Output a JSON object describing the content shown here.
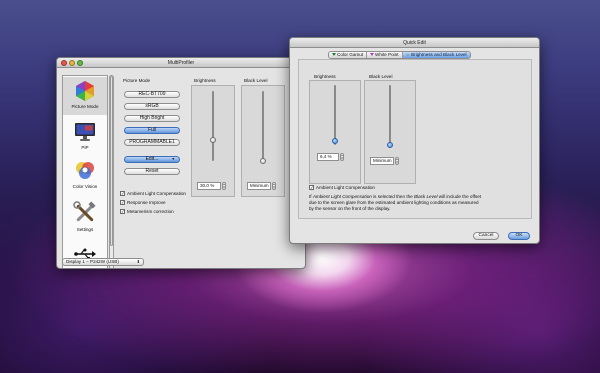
{
  "multiprofiler": {
    "title": "MultiProfiler",
    "sidebar": [
      {
        "label": "Picture Mode",
        "icon": "color-hexagon-icon",
        "selected": true
      },
      {
        "label": "PiP",
        "icon": "monitor-icon"
      },
      {
        "label": "Color Vision",
        "icon": "color-vision-icon"
      },
      {
        "label": "Settings",
        "icon": "tools-icon"
      },
      {
        "label": "",
        "icon": "usb-icon"
      }
    ],
    "picture_mode": {
      "heading": "Picture Mode",
      "buttons": [
        {
          "label": "REC-BT709",
          "active": false
        },
        {
          "label": "sRGB",
          "active": false
        },
        {
          "label": "High Bright",
          "active": false
        },
        {
          "label": "Full",
          "active": true
        },
        {
          "label": "PROGRAMMABLE1",
          "active": false
        }
      ],
      "edit_label": "Edit...",
      "reset_label": "Reset"
    },
    "brightness": {
      "heading": "Brightness",
      "value": "30,0 %",
      "level": 0.3
    },
    "black_level": {
      "heading": "Black Level",
      "value": "Minimum",
      "level": 0.0
    },
    "checkboxes": [
      {
        "label": "Ambient Light Compensation",
        "checked": true
      },
      {
        "label": "Response Improve",
        "checked": true
      },
      {
        "label": "Metamerism correction",
        "checked": true
      }
    ],
    "display_select": "Display 1 – P242W (USB)"
  },
  "quickedit": {
    "title": "Quick Edit",
    "tabs": [
      {
        "label": "Color Gamut",
        "selected": false
      },
      {
        "label": "White Point",
        "selected": false
      },
      {
        "label": "Brightness and Black Level",
        "selected": true
      }
    ],
    "brightness": {
      "heading": "Brightness",
      "value": "6,4 %",
      "level": 0.064
    },
    "black_level": {
      "heading": "Black Level",
      "value": "Minimum",
      "level": 0.0
    },
    "ambient_checkbox": {
      "label": "Ambient Light Compensation",
      "checked": true
    },
    "description": {
      "l1_pre": "If ",
      "l1_em1": "Ambient Light Compensation",
      "l1_mid": " is selected then the ",
      "l1_em2": "Black Level",
      "l1_post": " will include the offset",
      "l2": "due to the screen glare from the estimated ambient lighting conditions as measured",
      "l3": "by the sensor on the front of the display."
    },
    "cancel_label": "Cancel",
    "ok_label": "OK"
  },
  "colors": {
    "accent": "#5e93dc",
    "desktop_top": "#4a4f8c",
    "desktop_glow": "#d660c4"
  }
}
